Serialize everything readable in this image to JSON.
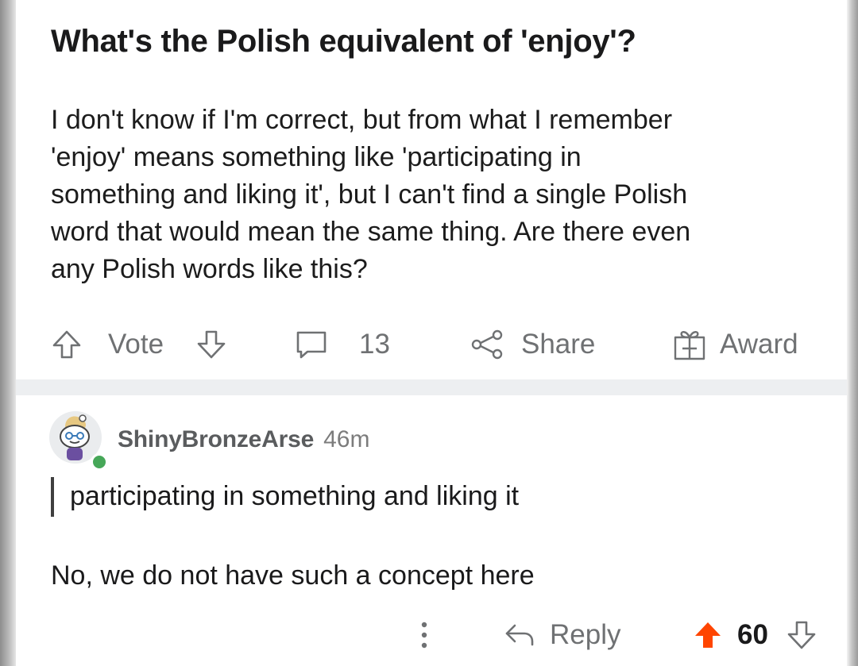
{
  "post": {
    "title": "What's the Polish equivalent of 'enjoy'?",
    "body_lines": [
      "I don't know if I'm correct, but from what I remember",
      "'enjoy' means something like 'participating in",
      "something and liking it', but I can't find a single Polish",
      "word that would mean the same thing. Are there even",
      "any Polish words like this?"
    ],
    "actions": {
      "vote_label": "Vote",
      "comment_count": "13",
      "share_label": "Share",
      "award_label": "Award"
    }
  },
  "comment": {
    "username": "ShinyBronzeArse",
    "time": "46m",
    "quote": "participating in something and liking it",
    "text": "No, we do not have such a concept here",
    "actions": {
      "more_icon": "more-vertical-icon",
      "reply_label": "Reply",
      "vote_count": "60",
      "upvoted": true
    }
  },
  "colors": {
    "upvote_active": "#ff4500",
    "action_gray": "#6f7173",
    "online": "#46a758",
    "divider": "#edeff1"
  }
}
